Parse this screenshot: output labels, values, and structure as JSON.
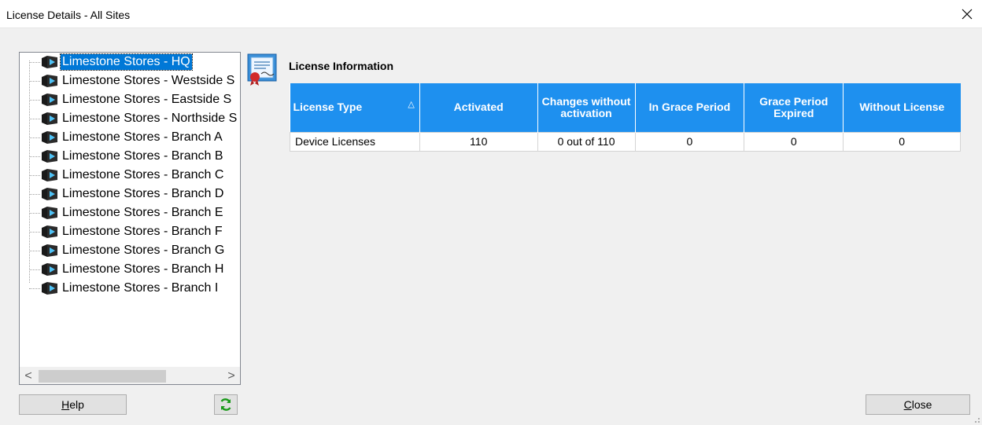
{
  "window": {
    "title": "License Details - All Sites",
    "close_glyph": "✕"
  },
  "tree": {
    "items": [
      {
        "label": "Limestone Stores - HQ",
        "selected": true
      },
      {
        "label": "Limestone Stores - Westside S"
      },
      {
        "label": "Limestone Stores - Eastside S"
      },
      {
        "label": "Limestone Stores - Northside S"
      },
      {
        "label": "Limestone Stores - Branch A"
      },
      {
        "label": "Limestone Stores - Branch B"
      },
      {
        "label": "Limestone Stores - Branch C"
      },
      {
        "label": "Limestone Stores - Branch D"
      },
      {
        "label": "Limestone Stores - Branch E"
      },
      {
        "label": "Limestone Stores - Branch F"
      },
      {
        "label": "Limestone Stores - Branch G"
      },
      {
        "label": "Limestone Stores - Branch H"
      },
      {
        "label": "Limestone Stores - Branch  I"
      }
    ],
    "node_icon": "store-icon"
  },
  "scrollbar": {
    "left_arrow": "<",
    "right_arrow": ">"
  },
  "buttons": {
    "help_label": "Help",
    "help_mnemonic": "H",
    "help_rest": "elp",
    "refresh_icon": "refresh-icon",
    "close_label": "Close",
    "close_mnemonic": "C",
    "close_rest": "lose"
  },
  "license_info": {
    "title": "License Information",
    "icon": "certificate-icon",
    "columns": [
      "License Type",
      "Activated",
      "Changes without activation",
      "In Grace Period",
      "Grace Period Expired",
      "Without License"
    ],
    "sort_indicator": "△",
    "rows": [
      [
        "Device Licenses",
        "110",
        "0 out of 110",
        "0",
        "0",
        "0"
      ]
    ]
  },
  "colors": {
    "header_blue": "#1e90ef",
    "selection_blue": "#0078d7"
  }
}
